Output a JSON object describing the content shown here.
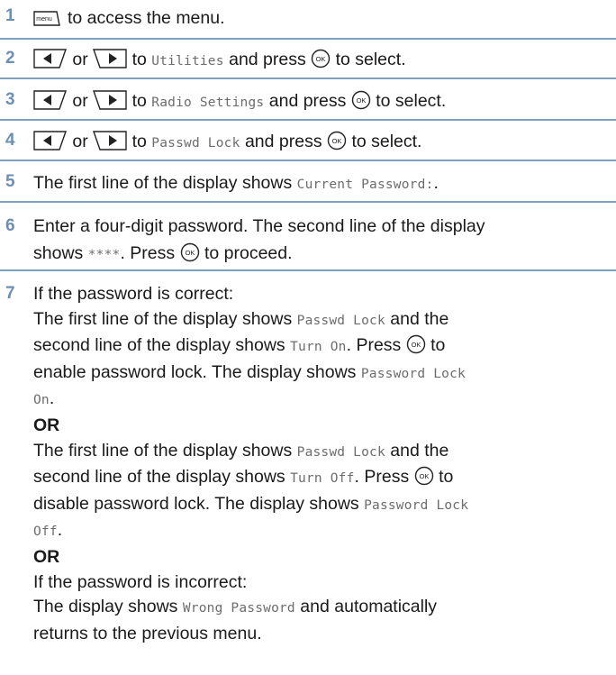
{
  "icons": {
    "menu_key": "menu-key-icon",
    "left_key": "left-arrow-key-icon",
    "right_key": "right-arrow-key-icon",
    "ok_key": "ok-key-icon",
    "menu_key_text": "menu",
    "ok_key_text": "OK"
  },
  "colors": {
    "step_number": "#6d8fb6",
    "divider": "#7f9fc0",
    "mono_text": "#6c6c6c"
  },
  "steps": [
    {
      "number": "1",
      "text": "to access the menu."
    },
    {
      "number": "2",
      "or": "or",
      "to": "to",
      "target": "Utilities",
      "and_press": "and press",
      "to_select": "to select."
    },
    {
      "number": "3",
      "or": "or",
      "to": "to",
      "target": "Radio Settings",
      "and_press": "and press",
      "to_select": "to select."
    },
    {
      "number": "4",
      "or": "or",
      "to": "to",
      "target": "Passwd Lock",
      "and_press": "and press",
      "to_select": "to select."
    },
    {
      "number": "5",
      "text": "The first line of the display shows",
      "mono": "Current Password:",
      "end": "."
    },
    {
      "number": "6",
      "line1": "Enter a four-digit password. The second line of the display",
      "shows": "shows",
      "mono": "****",
      "press": ". Press",
      "to_proceed": "to proceed."
    },
    {
      "number": "7"
    }
  ],
  "step7": {
    "intro": "If the password is correct:",
    "p1a": "The first line of the display shows",
    "p1_mono": "Passwd Lock",
    "p1b": "and the",
    "p1c": "second line of the display shows",
    "p1_mono2": "Turn On",
    "p1d": ". Press",
    "p1e": "to",
    "p1f": "enable password lock. The display shows",
    "p1_mono3": "Password Lock",
    "p1_mono3b": "On",
    "p1g": ".",
    "or1": "OR",
    "p2a": "The first line of the display shows",
    "p2_mono": "Passwd Lock",
    "p2b": " and the",
    "p2c": "second line of the display shows",
    "p2_mono2": "Turn Off",
    "p2d": ". Press",
    "p2e": "to",
    "p2f": "disable password lock. The display shows",
    "p2_mono3": "Password Lock",
    "p2_mono3b": "Off",
    "p2g": ".",
    "or2": "OR",
    "p3a": "If the password is incorrect:",
    "p3b": "The display shows",
    "p3_mono": "Wrong Password",
    "p3c": "and automatically",
    "p3d": "returns to the previous menu."
  }
}
